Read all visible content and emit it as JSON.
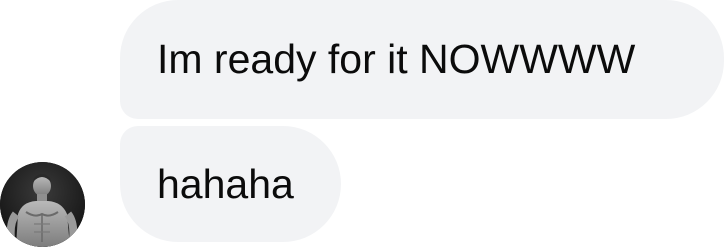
{
  "messages": [
    {
      "text": "Im ready for it NOWWWW"
    },
    {
      "text": "hahaha"
    }
  ],
  "avatar": {
    "icon": "user-avatar-photo"
  },
  "colors": {
    "bubble": "#f2f3f5",
    "text": "#0b0b0b",
    "background": "#ffffff"
  }
}
